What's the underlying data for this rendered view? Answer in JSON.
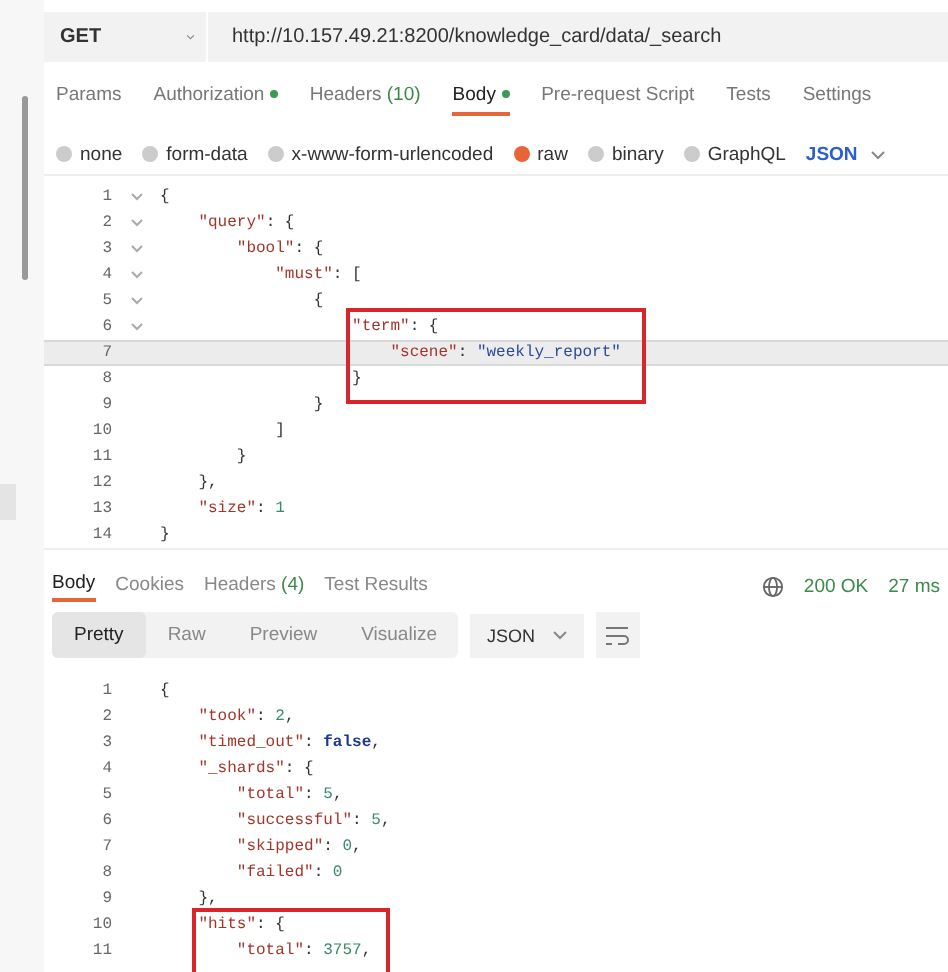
{
  "request": {
    "method": "GET",
    "url": "http://10.157.49.21:8200/knowledge_card/data/_search"
  },
  "request_tabs": [
    {
      "label": "Params",
      "dot": false,
      "selected": false
    },
    {
      "label": "Authorization",
      "dot": true,
      "selected": false
    },
    {
      "label": "Headers",
      "count": "(10)",
      "dot": false,
      "selected": false
    },
    {
      "label": "Body",
      "dot": true,
      "selected": true
    },
    {
      "label": "Pre-request Script",
      "dot": false,
      "selected": false
    },
    {
      "label": "Tests",
      "dot": false,
      "selected": false
    },
    {
      "label": "Settings",
      "dot": false,
      "selected": false
    }
  ],
  "body_types": [
    {
      "label": "none",
      "selected": false
    },
    {
      "label": "form-data",
      "selected": false
    },
    {
      "label": "x-www-form-urlencoded",
      "selected": false
    },
    {
      "label": "raw",
      "selected": true
    },
    {
      "label": "binary",
      "selected": false
    },
    {
      "label": "GraphQL",
      "selected": false
    }
  ],
  "body_format": "JSON",
  "request_editor": [
    {
      "no": "1",
      "fold": true,
      "current": false,
      "boxed": false,
      "tokens": [
        {
          "kind": "punct",
          "s": "{"
        }
      ]
    },
    {
      "no": "2",
      "fold": true,
      "current": false,
      "boxed": false,
      "tokens": [
        {
          "kind": "key",
          "s": "    \"query\""
        },
        {
          "kind": "punct",
          "s": ": {"
        }
      ]
    },
    {
      "no": "3",
      "fold": true,
      "current": false,
      "boxed": false,
      "tokens": [
        {
          "kind": "key",
          "s": "        \"bool\""
        },
        {
          "kind": "punct",
          "s": ": {"
        }
      ]
    },
    {
      "no": "4",
      "fold": true,
      "current": false,
      "boxed": false,
      "tokens": [
        {
          "kind": "key",
          "s": "            \"must\""
        },
        {
          "kind": "punct",
          "s": ": ["
        }
      ]
    },
    {
      "no": "5",
      "fold": true,
      "current": false,
      "boxed": false,
      "tokens": [
        {
          "kind": "punct",
          "s": "                {"
        }
      ]
    },
    {
      "no": "6",
      "fold": true,
      "current": false,
      "boxed": true,
      "tokens": [
        {
          "kind": "key",
          "s": "                    \"term\""
        },
        {
          "kind": "punct",
          "s": ": {"
        }
      ]
    },
    {
      "no": "7",
      "fold": false,
      "current": true,
      "boxed": true,
      "tokens": [
        {
          "kind": "key",
          "s": "                        \"scene\""
        },
        {
          "kind": "punct",
          "s": ": "
        },
        {
          "kind": "string",
          "s": "\"weekly_report\""
        }
      ]
    },
    {
      "no": "8",
      "fold": false,
      "current": false,
      "boxed": true,
      "tokens": [
        {
          "kind": "punct",
          "s": "                    }"
        }
      ]
    },
    {
      "no": "9",
      "fold": false,
      "current": false,
      "boxed": false,
      "tokens": [
        {
          "kind": "punct",
          "s": "                }"
        }
      ]
    },
    {
      "no": "10",
      "fold": false,
      "current": false,
      "boxed": false,
      "tokens": [
        {
          "kind": "punct",
          "s": "            ]"
        }
      ]
    },
    {
      "no": "11",
      "fold": false,
      "current": false,
      "boxed": false,
      "tokens": [
        {
          "kind": "punct",
          "s": "        }"
        }
      ]
    },
    {
      "no": "12",
      "fold": false,
      "current": false,
      "boxed": false,
      "tokens": [
        {
          "kind": "punct",
          "s": "    },"
        }
      ]
    },
    {
      "no": "13",
      "fold": false,
      "current": false,
      "boxed": false,
      "tokens": [
        {
          "kind": "key",
          "s": "    \"size\""
        },
        {
          "kind": "punct",
          "s": ": "
        },
        {
          "kind": "number",
          "s": "1"
        }
      ]
    },
    {
      "no": "14",
      "fold": false,
      "current": false,
      "boxed": false,
      "tokens": [
        {
          "kind": "punct",
          "s": "}"
        }
      ]
    }
  ],
  "response_tabs": [
    {
      "label": "Body",
      "selected": true
    },
    {
      "label": "Cookies",
      "selected": false
    },
    {
      "label": "Headers",
      "count": "(4)",
      "selected": false
    },
    {
      "label": "Test Results",
      "selected": false
    }
  ],
  "status": "200 OK",
  "time": "27 ms",
  "views": [
    {
      "label": "Pretty",
      "selected": true
    },
    {
      "label": "Raw",
      "selected": false
    },
    {
      "label": "Preview",
      "selected": false
    },
    {
      "label": "Visualize",
      "selected": false
    }
  ],
  "response_format": "JSON",
  "response_editor": [
    {
      "no": "1",
      "boxed": false,
      "tokens": [
        {
          "kind": "punct",
          "s": "{"
        }
      ]
    },
    {
      "no": "2",
      "boxed": false,
      "tokens": [
        {
          "kind": "key",
          "s": "    \"took\""
        },
        {
          "kind": "punct",
          "s": ": "
        },
        {
          "kind": "number",
          "s": "2"
        },
        {
          "kind": "punct",
          "s": ","
        }
      ]
    },
    {
      "no": "3",
      "boxed": false,
      "tokens": [
        {
          "kind": "key",
          "s": "    \"timed_out\""
        },
        {
          "kind": "punct",
          "s": ": "
        },
        {
          "kind": "bool",
          "s": "false"
        },
        {
          "kind": "punct",
          "s": ","
        }
      ]
    },
    {
      "no": "4",
      "boxed": false,
      "tokens": [
        {
          "kind": "key",
          "s": "    \"_shards\""
        },
        {
          "kind": "punct",
          "s": ": {"
        }
      ]
    },
    {
      "no": "5",
      "boxed": false,
      "tokens": [
        {
          "kind": "key",
          "s": "        \"total\""
        },
        {
          "kind": "punct",
          "s": ": "
        },
        {
          "kind": "number",
          "s": "5"
        },
        {
          "kind": "punct",
          "s": ","
        }
      ]
    },
    {
      "no": "6",
      "boxed": false,
      "tokens": [
        {
          "kind": "key",
          "s": "        \"successful\""
        },
        {
          "kind": "punct",
          "s": ": "
        },
        {
          "kind": "number",
          "s": "5"
        },
        {
          "kind": "punct",
          "s": ","
        }
      ]
    },
    {
      "no": "7",
      "boxed": false,
      "tokens": [
        {
          "kind": "key",
          "s": "        \"skipped\""
        },
        {
          "kind": "punct",
          "s": ": "
        },
        {
          "kind": "number",
          "s": "0"
        },
        {
          "kind": "punct",
          "s": ","
        }
      ]
    },
    {
      "no": "8",
      "boxed": false,
      "tokens": [
        {
          "kind": "key",
          "s": "        \"failed\""
        },
        {
          "kind": "punct",
          "s": ": "
        },
        {
          "kind": "number",
          "s": "0"
        }
      ]
    },
    {
      "no": "9",
      "boxed": false,
      "tokens": [
        {
          "kind": "punct",
          "s": "    },"
        }
      ]
    },
    {
      "no": "10",
      "boxed": true,
      "tokens": [
        {
          "kind": "key",
          "s": "    \"hits\""
        },
        {
          "kind": "punct",
          "s": ": {"
        }
      ]
    },
    {
      "no": "11",
      "boxed": true,
      "tokens": [
        {
          "kind": "key",
          "s": "        \"total\""
        },
        {
          "kind": "punct",
          "s": ": "
        },
        {
          "kind": "number",
          "s": "3757"
        },
        {
          "kind": "punct",
          "s": ","
        }
      ]
    }
  ]
}
